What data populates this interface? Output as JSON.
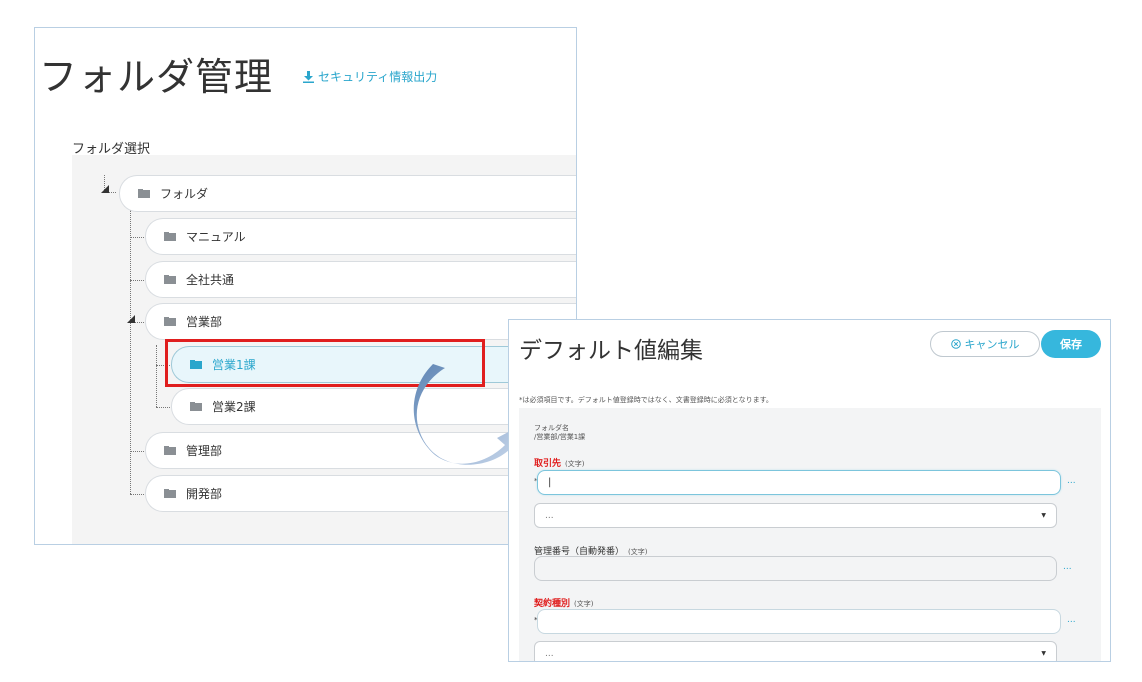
{
  "folder_panel": {
    "title": "フォルダ管理",
    "export_link": "セキュリティ情報出力",
    "section_label": "フォルダ選択",
    "tree": {
      "root": "フォルダ",
      "items": [
        {
          "label": "マニュアル"
        },
        {
          "label": "全社共通"
        },
        {
          "label": "営業部"
        },
        {
          "label": "営業1課",
          "selected": true
        },
        {
          "label": "営業2課"
        },
        {
          "label": "管理部"
        },
        {
          "label": "開発部"
        }
      ]
    }
  },
  "dialog": {
    "title": "デフォルト値編集",
    "cancel_label": "キャンセル",
    "save_label": "保存",
    "required_note": "*は必須項目です。デフォルト値登録時ではなく、文書登録時に必須となります。",
    "folder_name_label": "フォルダ名",
    "folder_path": "/営業部/営業1課",
    "fields": [
      {
        "label": "取引先",
        "type": "(文字)",
        "required": true,
        "value": "|",
        "select_value": "..."
      },
      {
        "label": "管理番号（自動発番）",
        "type": "(文字)",
        "required": false,
        "value": ""
      },
      {
        "label": "契約種別",
        "type": "(文字)",
        "required": true,
        "value": "",
        "select_value": "..."
      }
    ],
    "more_label": "...",
    "required_marker": "*"
  },
  "colors": {
    "accent": "#2aa6cc",
    "save_button": "#36b7dd",
    "required": "#e01e1e",
    "highlight_box": "#e01e1e"
  }
}
